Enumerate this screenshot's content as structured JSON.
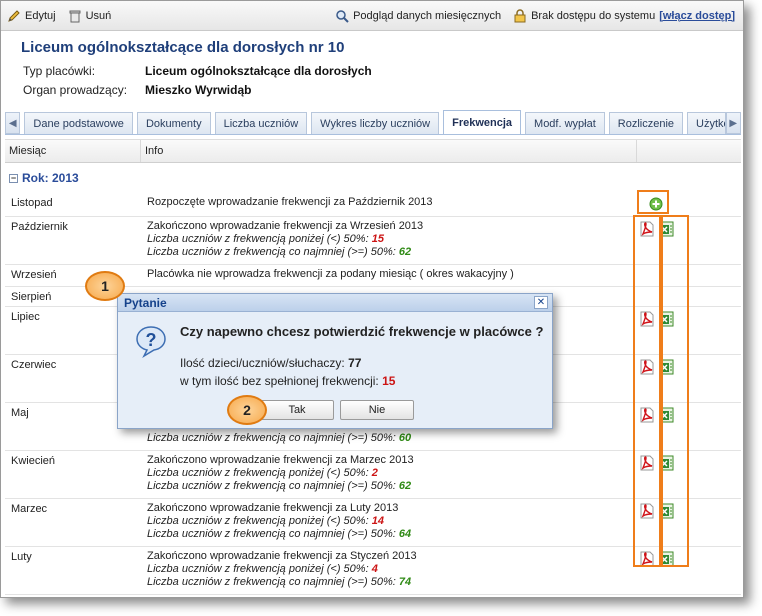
{
  "toolbar": {
    "edit_label": "Edytuj",
    "delete_label": "Usuń",
    "monthly_label": "Podgląd danych miesięcznych",
    "access_label": "Brak dostępu do systemu",
    "access_link": "[włącz dostęp]"
  },
  "header": {
    "title": "Liceum ogólnokształcące dla dorosłych nr 10",
    "type_key": "Typ placówki:",
    "type_val": "Liceum ogólnokształcące dla dorosłych",
    "organ_key": "Organ prowadzący:",
    "organ_val": "Mieszko Wyrwidąb"
  },
  "tabs": [
    "Dane podstawowe",
    "Dokumenty",
    "Liczba uczniów",
    "Wykres liczby uczniów",
    "Frekwencja",
    "Modf. wypłat",
    "Rozliczenie",
    "Użytko"
  ],
  "active_tab": "Frekwencja",
  "table": {
    "col_month": "Miesiąc",
    "col_info": "Info",
    "year_label": "Rok: 2013",
    "below_label": "Liczba uczniów z frekwencją poniżej (<) 50%:",
    "above_label": "Liczba uczniów z frekwencją co najmniej (>=) 50%:",
    "rows": [
      {
        "month": "Listopad",
        "info": "Rozpoczęte wprowadzanie frekwencji za Październik 2013"
      },
      {
        "month": "Październik",
        "info": "Zakończono wprowadzanie frekwencji za Wrzesień 2013",
        "below": "15",
        "above": "62"
      },
      {
        "month": "Wrzesień",
        "info": "Placówka nie wprowadza frekwencji za podany miesiąc ( okres wakacyjny )"
      },
      {
        "month": "Sierpień",
        "info": ""
      },
      {
        "month": "Lipiec",
        "info": ""
      },
      {
        "month": "Czerwiec",
        "info": ""
      },
      {
        "month": "Maj",
        "info": "",
        "above": "60"
      },
      {
        "month": "Kwiecień",
        "info": "Zakończono wprowadzanie frekwencji za Marzec 2013",
        "below": "2",
        "above": "62"
      },
      {
        "month": "Marzec",
        "info": "Zakończono wprowadzanie frekwencji za Luty 2013",
        "below": "14",
        "above": "64"
      },
      {
        "month": "Luty",
        "info": "Zakończono wprowadzanie frekwencji za Styczeń 2013",
        "below": "4",
        "above": "74"
      }
    ]
  },
  "dialog": {
    "title": "Pytanie",
    "question": "Czy napewno chcesz potwierdzić frekwencje w placówce ?",
    "line1_label": "Ilość dzieci/uczniów/słuchaczy:",
    "line1_value": "77",
    "line2_label": "w tym ilość bez spełnionej frekwencji:",
    "line2_value": "15",
    "yes_label": "Tak",
    "no_label": "Nie"
  },
  "badges": {
    "one": "1",
    "two": "2"
  },
  "colors": {
    "highlight": "#ef7d1a",
    "accent": "#2a4c9a",
    "red": "#cc1414",
    "green": "#2f8a15"
  }
}
